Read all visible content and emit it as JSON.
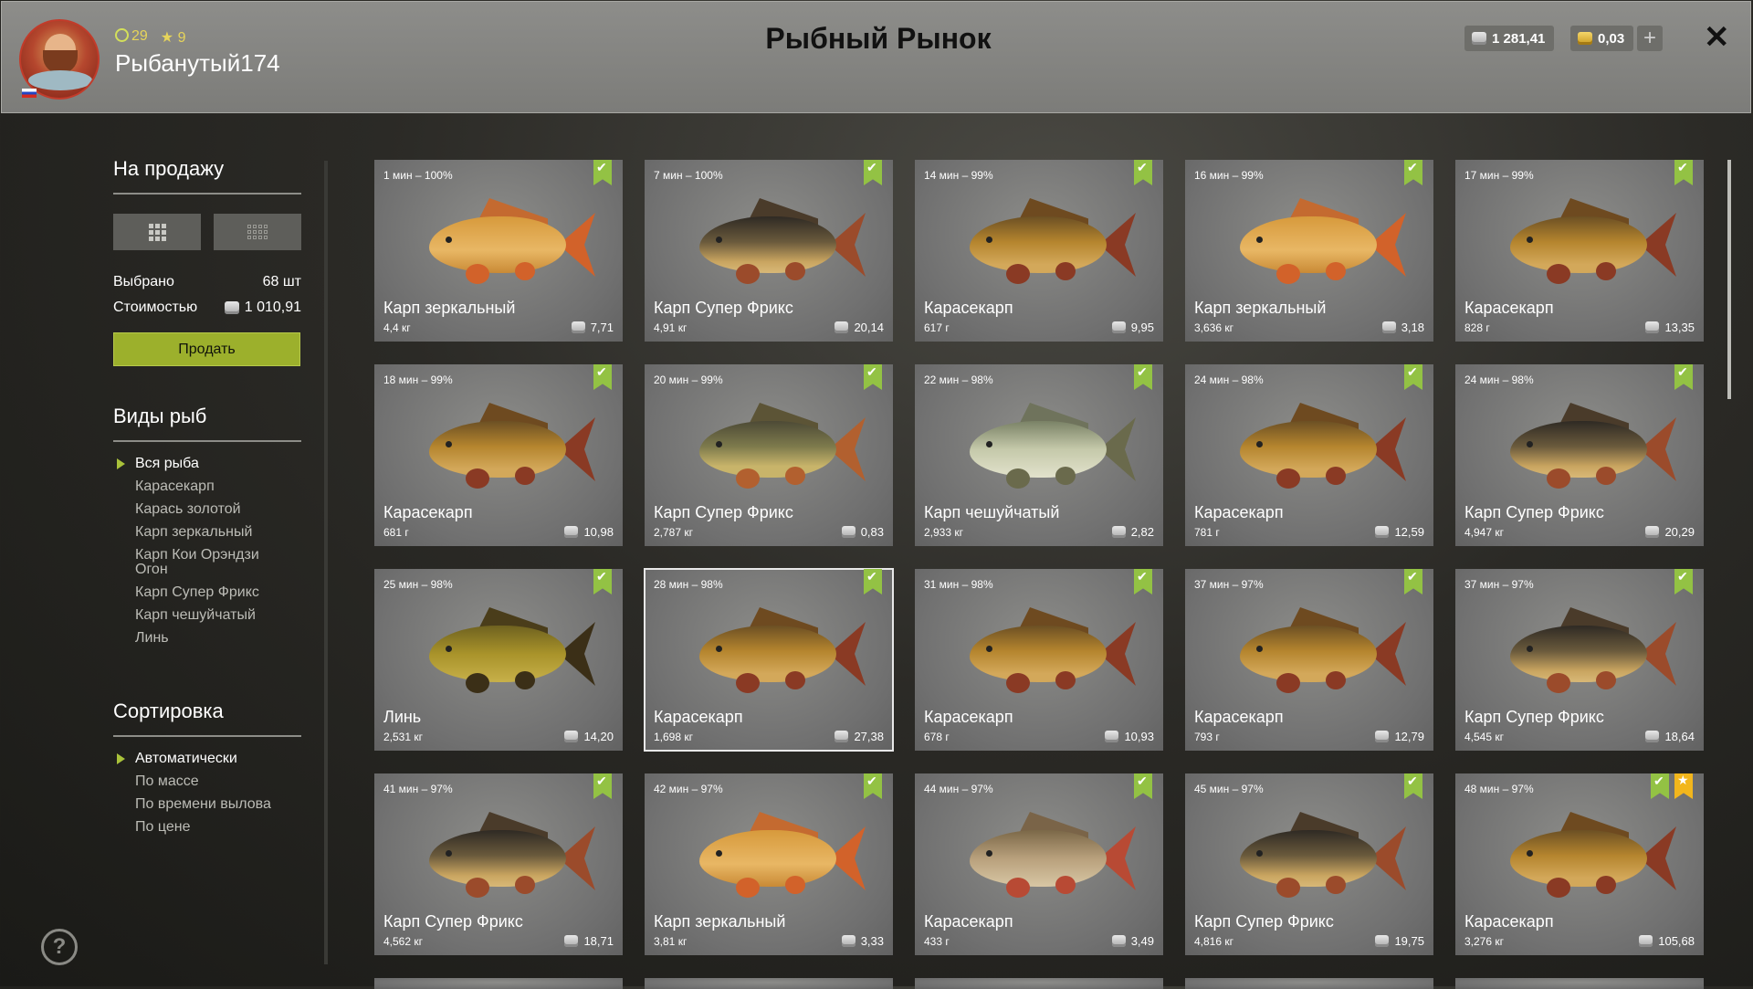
{
  "header": {
    "title": "Рыбный Рынок",
    "username": "Рыбанутый174",
    "level": "29",
    "stars": "9",
    "silver": "1 281,41",
    "gold": "0,03",
    "plus": "+",
    "close": "✕"
  },
  "sidebar": {
    "for_sale_title": "На продажу",
    "selected_label": "Выбрано",
    "selected_value": "68 шт",
    "cost_label": "Стоимостью",
    "cost_value": "1 010,91",
    "sell_button": "Продать",
    "species_title": "Виды рыб",
    "species": [
      "Вся рыба",
      "Карасекарп",
      "Карась золотой",
      "Карп зеркальный",
      "Карп Кои Орэндзи Огон",
      "Карп Супер Фрикс",
      "Карп чешуйчатый",
      "Линь"
    ],
    "sort_title": "Сортировка",
    "sort": [
      "Автоматически",
      "По массе",
      "По времени вылова",
      "По цене"
    ],
    "help": "?"
  },
  "colors": {
    "accent": "#9cb02c",
    "tag_green": "#93c244",
    "tag_star": "#f2b61c"
  },
  "cards": [
    {
      "time": "1 мин – 100%",
      "name": "Карп зеркальный",
      "weight": "4,4 кг",
      "price": "7,71",
      "fish": "mirror"
    },
    {
      "time": "7 мин – 100%",
      "name": "Карп Супер Фрикс",
      "weight": "4,91 кг",
      "price": "20,14",
      "fish": "freaks"
    },
    {
      "time": "14 мин – 99%",
      "name": "Карасекарп",
      "weight": "617 г",
      "price": "9,95",
      "fish": "hybrid"
    },
    {
      "time": "16 мин – 99%",
      "name": "Карп зеркальный",
      "weight": "3,636 кг",
      "price": "3,18",
      "fish": "mirror"
    },
    {
      "time": "17 мин – 99%",
      "name": "Карасекарп",
      "weight": "828 г",
      "price": "13,35",
      "fish": "hybrid"
    },
    {
      "time": "18 мин – 99%",
      "name": "Карасекарп",
      "weight": "681 г",
      "price": "10,98",
      "fish": "hybrid"
    },
    {
      "time": "20 мин – 99%",
      "name": "Карп Супер Фрикс",
      "weight": "2,787 кг",
      "price": "0,83",
      "fish": "freaks2"
    },
    {
      "time": "22 мин – 98%",
      "name": "Карп чешуйчатый",
      "weight": "2,933 кг",
      "price": "2,82",
      "fish": "scaled"
    },
    {
      "time": "24 мин – 98%",
      "name": "Карасекарп",
      "weight": "781 г",
      "price": "12,59",
      "fish": "hybrid"
    },
    {
      "time": "24 мин – 98%",
      "name": "Карп Супер Фрикс",
      "weight": "4,947 кг",
      "price": "20,29",
      "fish": "freaks"
    },
    {
      "time": "25 мин – 98%",
      "name": "Линь",
      "weight": "2,531 кг",
      "price": "14,20",
      "fish": "tench"
    },
    {
      "time": "28 мин – 98%",
      "name": "Карасекарп",
      "weight": "1,698 кг",
      "price": "27,38",
      "fish": "hybrid",
      "selected": true
    },
    {
      "time": "31 мин – 98%",
      "name": "Карасекарп",
      "weight": "678 г",
      "price": "10,93",
      "fish": "hybrid"
    },
    {
      "time": "37 мин – 97%",
      "name": "Карасекарп",
      "weight": "793 г",
      "price": "12,79",
      "fish": "hybrid"
    },
    {
      "time": "37 мин – 97%",
      "name": "Карп Супер Фрикс",
      "weight": "4,545 кг",
      "price": "18,64",
      "fish": "freaks"
    },
    {
      "time": "41 мин – 97%",
      "name": "Карп Супер Фрикс",
      "weight": "4,562 кг",
      "price": "18,71",
      "fish": "freaks"
    },
    {
      "time": "42 мин – 97%",
      "name": "Карп зеркальный",
      "weight": "3,81 кг",
      "price": "3,33",
      "fish": "mirror"
    },
    {
      "time": "44 мин – 97%",
      "name": "Карасекарп",
      "weight": "433 г",
      "price": "3,49",
      "fish": "hybrid2"
    },
    {
      "time": "45 мин – 97%",
      "name": "Карп Супер Фрикс",
      "weight": "4,816 кг",
      "price": "19,75",
      "fish": "freaks"
    },
    {
      "time": "48 мин – 97%",
      "name": "Карасекарп",
      "weight": "3,276 кг",
      "price": "105,68",
      "fish": "hybrid",
      "star": true
    }
  ]
}
